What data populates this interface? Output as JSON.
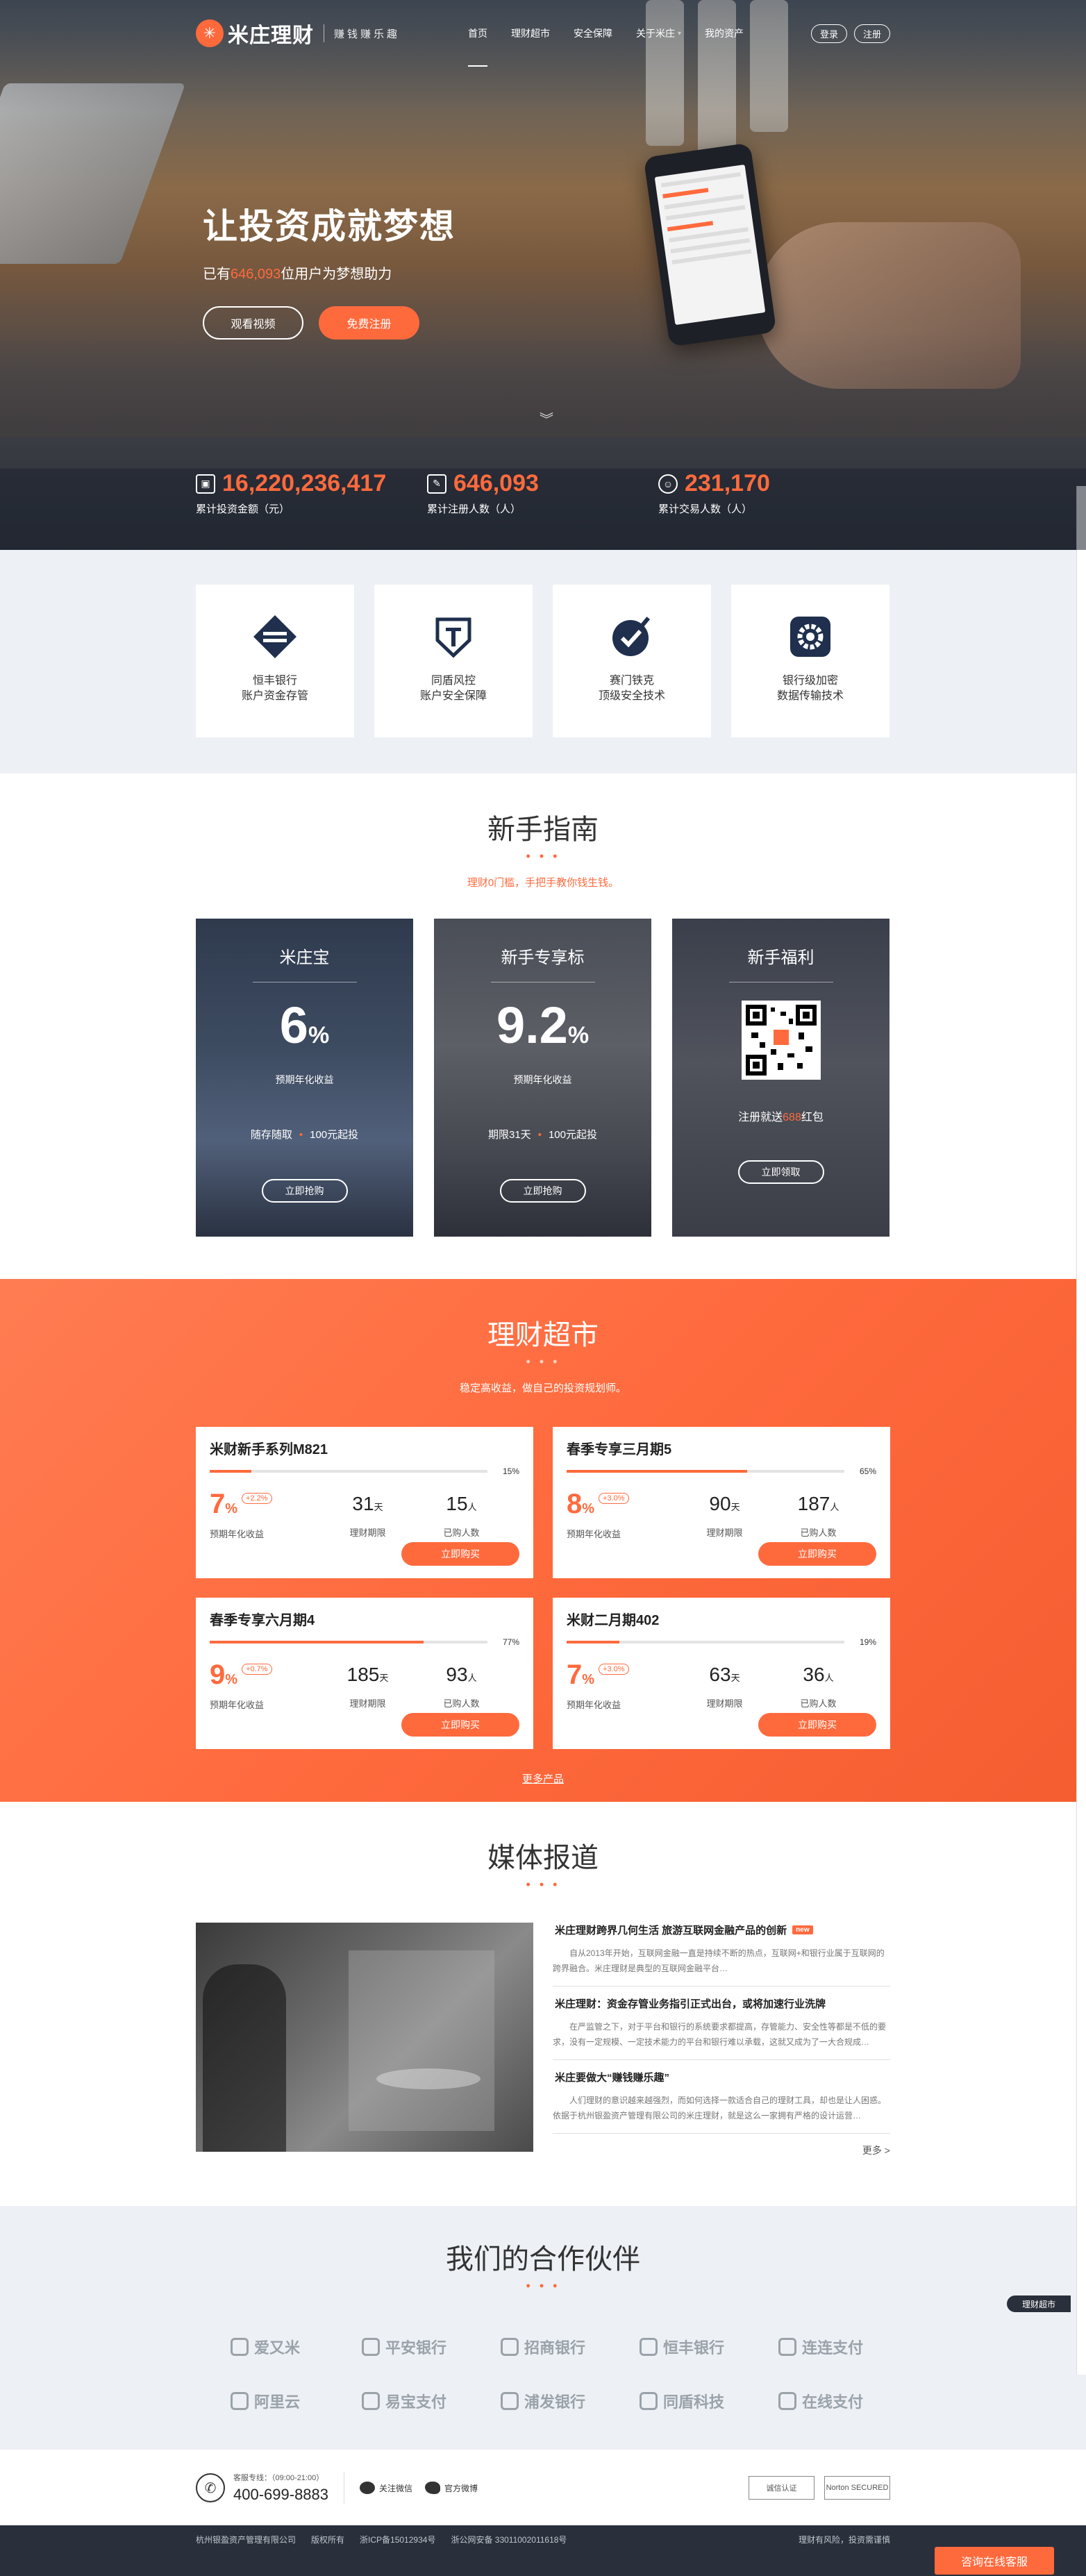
{
  "nav": {
    "logo_name": "米庄理财",
    "logo_slogan": "赚钱赚乐趣",
    "menu": [
      "首页",
      "理财超市",
      "安全保障",
      "关于米庄",
      "我的资产"
    ],
    "login": "登录",
    "register": "注册"
  },
  "hero": {
    "title": "让投资成就梦想",
    "sub_prefix": "已有",
    "sub_count": "646,093",
    "sub_suffix": "位用户为梦想助力",
    "btn_video": "观看视频",
    "btn_register": "免费注册"
  },
  "stats": [
    {
      "value": "16,220,236,417",
      "label": "累计投资金额（元）"
    },
    {
      "value": "646,093",
      "label": "累计注册人数（人）"
    },
    {
      "value": "231,170",
      "label": "累计交易人数（人）"
    }
  ],
  "trust": [
    {
      "line1": "恒丰银行",
      "line2": "账户资金存管"
    },
    {
      "line1": "同盾风控",
      "line2": "账户安全保障"
    },
    {
      "line1": "赛门铁克",
      "line2": "顶级安全技术"
    },
    {
      "line1": "银行级加密",
      "line2": "数据传输技术"
    }
  ],
  "guide": {
    "title": "新手指南",
    "dots": "• • •",
    "subtitle": "理财0门槛，手把手教你钱生钱。",
    "cards": [
      {
        "title": "米庄宝",
        "rate": "6",
        "unit": "%",
        "rate_label": "预期年化收益",
        "info_a": "随存随取",
        "info_b": "100元起投",
        "btn": "立即抢购"
      },
      {
        "title": "新手专享标",
        "rate": "9.2",
        "unit": "%",
        "rate_label": "预期年化收益",
        "info_a": "期限31天",
        "info_b": "100元起投",
        "btn": "立即抢购"
      },
      {
        "title": "新手福利",
        "note_prefix": "注册就送",
        "note_hl": "688",
        "note_suffix": "红包",
        "btn": "立即领取"
      }
    ]
  },
  "market": {
    "title": "理财超市",
    "dots": "• • •",
    "subtitle": "稳定高收益，做自己的投资规划师。",
    "more": "更多产品",
    "rate_label": "预期年化收益",
    "term_label": "理财期限",
    "buyers_label": "已购人数",
    "buy_btn": "立即购买",
    "products": [
      {
        "name": "米财新手系列M821",
        "progress": 0.15,
        "progress_text": "15%",
        "rate": "7",
        "bonus": "+2.2%",
        "term": "31",
        "term_unit": "天",
        "buyers": "15",
        "buyers_unit": "人"
      },
      {
        "name": "春季专享三月期5",
        "progress": 0.65,
        "progress_text": "65%",
        "rate": "8",
        "bonus": "+3.0%",
        "term": "90",
        "term_unit": "天",
        "buyers": "187",
        "buyers_unit": "人"
      },
      {
        "name": "春季专享六月期4",
        "progress": 0.77,
        "progress_text": "77%",
        "rate": "9",
        "bonus": "+0.7%",
        "term": "185",
        "term_unit": "天",
        "buyers": "93",
        "buyers_unit": "人"
      },
      {
        "name": "米财二月期402",
        "progress": 0.19,
        "progress_text": "19%",
        "rate": "7",
        "bonus": "+3.0%",
        "term": "63",
        "term_unit": "天",
        "buyers": "36",
        "buyers_unit": "人"
      }
    ]
  },
  "media": {
    "title": "媒体报道",
    "dots": "• • •",
    "news": [
      {
        "title": "米庄理财跨界几何生活 旅游互联网金融产品的创新",
        "badge": "new",
        "desc": "自从2013年开始，互联网金融一直是持续不断的热点，互联网+和银行业属于互联网的跨界融合。米庄理财是典型的互联网金融平台…"
      },
      {
        "title": "米庄理财：资金存管业务指引正式出台，或将加速行业洗牌",
        "desc": "在严监管之下，对于平台和银行的系统要求都提高，存管能力、安全性等都是不低的要求，没有一定规模、一定技术能力的平台和银行难以承载，这就又成为了一大合规成…"
      },
      {
        "title": "米庄要做大“赚钱赚乐趣”",
        "desc": "人们理财的意识越来越强烈，而如何选择一款适合自己的理财工具，却也是让人困惑。依据于杭州银盈资产管理有限公司的米庄理财，就是这么一家拥有严格的设计运营…"
      }
    ],
    "more": "更多 >"
  },
  "partners": {
    "title": "我们的合作伙伴",
    "dots": "• • •",
    "logos": [
      "爱又米",
      "平安银行",
      "招商银行",
      "恒丰银行",
      "连连支付",
      "阿里云",
      "易宝支付",
      "浦发银行",
      "同盾科技",
      "在线支付"
    ]
  },
  "footer": {
    "hotline_label": "客服专线：（09:00-21:00）",
    "hotline": "400-699-8883",
    "wechat": "关注微信",
    "weibo": "官方微博",
    "cert1": "诚信认证",
    "cert2": "Norton SECURED",
    "company": "杭州银盈资产管理有限公司",
    "rights": "版权所有",
    "icp": "浙ICP备15012934号",
    "police": "浙公网安备 33011002011618号",
    "risk": "理财有风险，投资需谨慎",
    "cs": "咨询在线客服",
    "side_tag": "理财超市"
  },
  "colors": {
    "accent": "#ff6a3d",
    "dark": "#2a303b",
    "light_bg": "#edf1f5"
  }
}
